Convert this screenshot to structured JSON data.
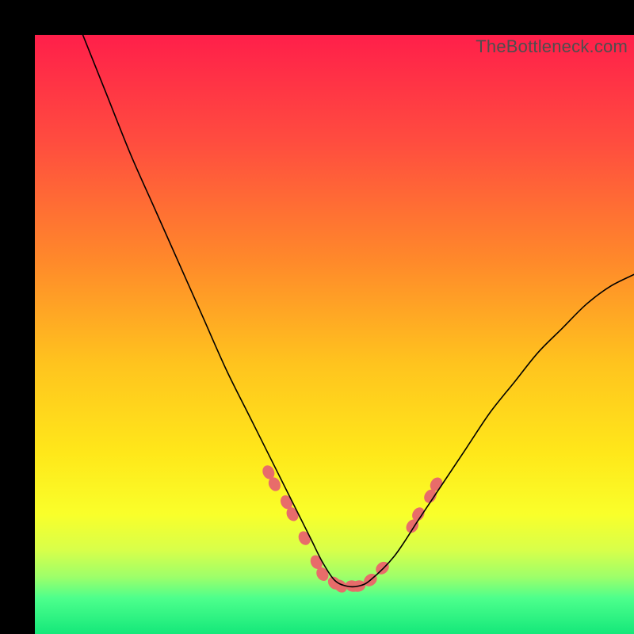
{
  "watermark": "TheBottleneck.com",
  "chart_data": {
    "type": "line",
    "title": "",
    "xlabel": "",
    "ylabel": "",
    "xlim": [
      0,
      100
    ],
    "ylim": [
      0,
      100
    ],
    "grid": false,
    "series": [
      {
        "name": "curve",
        "stroke": "#000000",
        "stroke_width": 1.6,
        "x": [
          8,
          12,
          16,
          20,
          24,
          28,
          32,
          36,
          40,
          43,
          46,
          48,
          50,
          52,
          54,
          56,
          60,
          64,
          68,
          72,
          76,
          80,
          84,
          88,
          92,
          96,
          100
        ],
        "y": [
          100,
          90,
          80,
          71,
          62,
          53,
          44,
          36,
          28,
          22,
          16,
          12,
          9,
          8,
          8,
          9,
          13,
          19,
          25,
          31,
          37,
          42,
          47,
          51,
          55,
          58,
          60
        ]
      }
    ],
    "markers": {
      "name": "dots",
      "fill": "#e86c6a",
      "r": 7.5,
      "points": [
        {
          "x": 39,
          "y": 27
        },
        {
          "x": 40,
          "y": 25
        },
        {
          "x": 42,
          "y": 22
        },
        {
          "x": 43,
          "y": 20
        },
        {
          "x": 45,
          "y": 16
        },
        {
          "x": 47,
          "y": 12
        },
        {
          "x": 48,
          "y": 10
        },
        {
          "x": 50,
          "y": 8.5
        },
        {
          "x": 51,
          "y": 8
        },
        {
          "x": 53,
          "y": 8
        },
        {
          "x": 54,
          "y": 8
        },
        {
          "x": 56,
          "y": 9
        },
        {
          "x": 58,
          "y": 11
        },
        {
          "x": 63,
          "y": 18
        },
        {
          "x": 64,
          "y": 20
        },
        {
          "x": 66,
          "y": 23
        },
        {
          "x": 67,
          "y": 25
        }
      ]
    },
    "gradient_stops": [
      {
        "offset": 0.0,
        "color": "#ff1f4a"
      },
      {
        "offset": 0.18,
        "color": "#ff4d3f"
      },
      {
        "offset": 0.38,
        "color": "#ff8a2a"
      },
      {
        "offset": 0.55,
        "color": "#ffc41e"
      },
      {
        "offset": 0.7,
        "color": "#ffe81a"
      },
      {
        "offset": 0.8,
        "color": "#f9ff2a"
      },
      {
        "offset": 0.86,
        "color": "#d8ff4a"
      },
      {
        "offset": 0.905,
        "color": "#9dff6a"
      },
      {
        "offset": 0.94,
        "color": "#4dff8c"
      },
      {
        "offset": 1.0,
        "color": "#15e87a"
      }
    ]
  }
}
